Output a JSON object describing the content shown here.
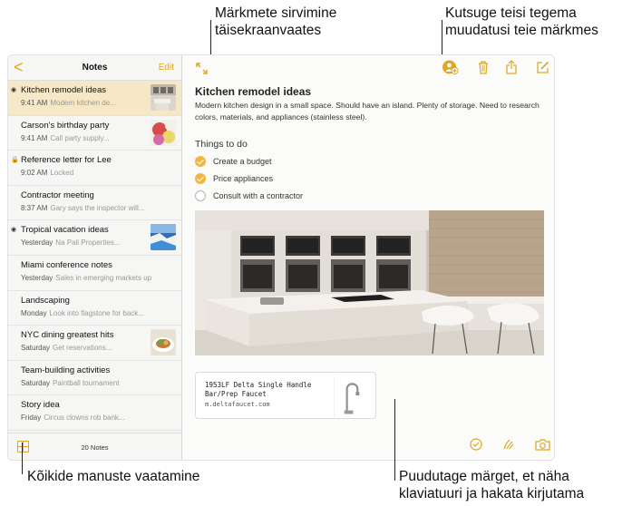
{
  "callouts": {
    "fullscreen_l1": "Märkmete sirvimine",
    "fullscreen_l2": "täisekraanvaates",
    "invite_l1": "Kutsuge teisi tegema",
    "invite_l2": "muudatusi teie märkmes",
    "attachments": "Kõikide manuste vaatamine",
    "tap_l1": "Puudutage märget, et näha",
    "tap_l2": "klaviatuuri ja hakata kirjutama"
  },
  "sidebar": {
    "back": "<",
    "title": "Notes",
    "edit": "Edit",
    "count": "20 Notes",
    "notes": [
      {
        "title": "Kitchen remodel ideas",
        "time": "9:41 AM",
        "preview": "Modern kitchen de...",
        "marker": "shared"
      },
      {
        "title": "Carson's birthday party",
        "time": "9:41 AM",
        "preview": "Call party supply..."
      },
      {
        "title": "Reference letter for Lee",
        "time": "9:02 AM",
        "preview": "Locked",
        "marker": "lock"
      },
      {
        "title": "Contractor meeting",
        "time": "8:37 AM",
        "preview": "Gary says the inspector will..."
      },
      {
        "title": "Tropical vacation ideas",
        "time": "Yesterday",
        "preview": "Na Pali Properties...",
        "marker": "shared"
      },
      {
        "title": "Miami conference notes",
        "time": "Yesterday",
        "preview": "Sales in emerging markets up"
      },
      {
        "title": "Landscaping",
        "time": "Monday",
        "preview": "Look into flagstone for back..."
      },
      {
        "title": "NYC dining greatest hits",
        "time": "Saturday",
        "preview": "Get reservations..."
      },
      {
        "title": "Team-building activities",
        "time": "Saturday",
        "preview": "Paintball tournament"
      },
      {
        "title": "Story idea",
        "time": "Friday",
        "preview": "Circus clowns rob bank..."
      }
    ]
  },
  "note": {
    "title": "Kitchen remodel ideas",
    "body": "Modern kitchen design in a small space. Should have an island. Plenty of storage. Need to research colors, materials, and appliances (stainless steel).",
    "things_heading": "Things to do",
    "checklist": [
      {
        "label": "Create a budget",
        "done": true
      },
      {
        "label": "Price appliances",
        "done": true
      },
      {
        "label": "Consult with a contractor",
        "done": false
      }
    ],
    "link": {
      "title": "1953LF Delta Single Handle Bar/Prep Faucet",
      "url": "m.deltafaucet.com"
    }
  },
  "colors": {
    "accent": "#e0a523",
    "selected_row": "#f6e8c6"
  },
  "icons": {
    "fullscreen": "expand-arrows-icon",
    "collaborate": "add-person-icon",
    "trash": "trash-icon",
    "share": "share-icon",
    "compose": "compose-icon",
    "attachments": "grid-icon",
    "checklist": "checkmark-circle-icon",
    "sketch": "sketch-icon",
    "camera": "camera-icon"
  }
}
